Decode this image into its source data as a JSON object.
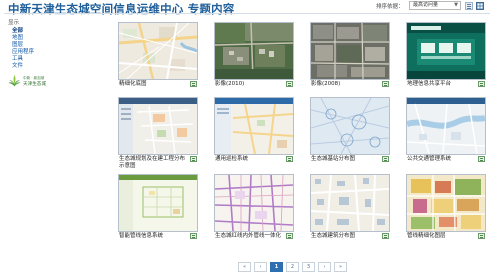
{
  "header": {
    "title": "中新天津生态城空间信息运维中心 专题内容",
    "sort_label": "排序依据：",
    "sort_value": "最高访问量",
    "view_buttons": [
      "list-view",
      "grid-view"
    ]
  },
  "sidebar": {
    "show_label": "显示",
    "items": [
      "全部",
      "地图",
      "图层",
      "应用程序",
      "工具",
      "文件"
    ],
    "active_item": "全部",
    "logo_line1": "中新 · 新加坡",
    "logo_line2": "天津生态城"
  },
  "cards": [
    {
      "title": "精细化底图",
      "thumb_type": "street-map"
    },
    {
      "title": "影像(2010)",
      "thumb_type": "satellite"
    },
    {
      "title": "影像(2008)",
      "thumb_type": "satellite-urban"
    },
    {
      "title": "地理信息共享平台",
      "thumb_type": "web-app"
    },
    {
      "title": "生态城规划及在建工程分布示意图",
      "thumb_type": "planning-app"
    },
    {
      "title": "通用巡检系统",
      "thumb_type": "inspection-app"
    },
    {
      "title": "生态城基站分布图",
      "thumb_type": "base-station-map"
    },
    {
      "title": "公共交通管理系统",
      "thumb_type": "transit-app"
    },
    {
      "title": "智能管线信息系统",
      "thumb_type": "pipeline-map"
    },
    {
      "title": "生态城红线内外管线一体化",
      "thumb_type": "redline-map"
    },
    {
      "title": "生态城建筑分布图",
      "thumb_type": "building-map"
    },
    {
      "title": "管线精细化图层",
      "thumb_type": "zoning-map"
    }
  ],
  "pagination": {
    "first": "«",
    "prev": "‹",
    "pages": [
      "1",
      "2",
      "3"
    ],
    "current": "1",
    "next": "›",
    "last": "»"
  },
  "colors": {
    "title_blue": "#1f5f9a",
    "link_blue": "#0c54a6",
    "page_active": "#2d6fb0",
    "thumb_border": "#b5c0cc"
  }
}
